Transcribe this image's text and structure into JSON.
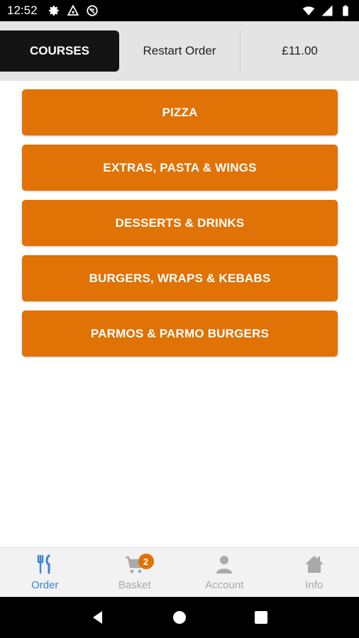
{
  "status_bar": {
    "time": "12:52",
    "icons": [
      "gear-icon",
      "triangle-icon",
      "circle-slash-icon",
      "wifi-icon",
      "signal-icon",
      "battery-icon"
    ]
  },
  "top_bar": {
    "courses_label": "COURSES",
    "restart_label": "Restart Order",
    "total_label": "£11.00"
  },
  "categories": [
    {
      "label": "PIZZA"
    },
    {
      "label": "EXTRAS, PASTA & WINGS"
    },
    {
      "label": "DESSERTS & DRINKS"
    },
    {
      "label": "BURGERS, WRAPS & KEBABS"
    },
    {
      "label": "PARMOS & PARMO BURGERS"
    }
  ],
  "bottom_nav": {
    "items": [
      {
        "label": "Order",
        "icon": "fork-knife-icon",
        "active": true
      },
      {
        "label": "Basket",
        "icon": "cart-icon",
        "badge": "2"
      },
      {
        "label": "Account",
        "icon": "person-icon"
      },
      {
        "label": "Info",
        "icon": "home-icon"
      }
    ]
  },
  "colors": {
    "accent": "#e07206",
    "active_nav": "#3a84d6",
    "dark_tab": "#141414",
    "top_bar_bg": "#e4e4e4"
  }
}
